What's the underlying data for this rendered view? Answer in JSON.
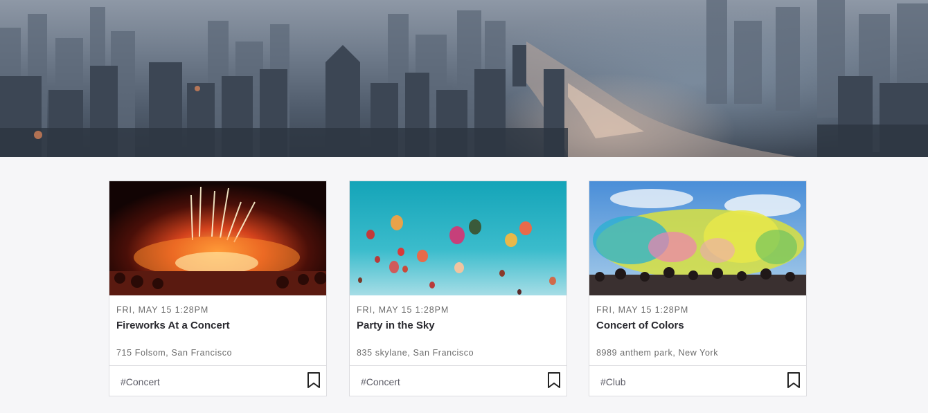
{
  "hero": {
    "icon": "city-skyline-image"
  },
  "cards": [
    {
      "date": "FRI, MAY 15 1:28PM",
      "title": "Fireworks At a Concert",
      "address": "715 Folsom, San Francisco",
      "tag": "#Concert",
      "image": "fireworks-concert-image"
    },
    {
      "date": "FRI, MAY 15 1:28PM",
      "title": "Party in the Sky",
      "address": "835 skylane, San Francisco",
      "tag": "#Concert",
      "image": "hot-air-balloons-image"
    },
    {
      "date": "FRI, MAY 15 1:28PM",
      "title": "Concert of Colors",
      "address": "8989 anthem park, New York",
      "tag": "#Club",
      "image": "color-powder-festival-image"
    }
  ],
  "colors": {
    "page_bg": "#f6f6f8",
    "card_border": "#dcdce0",
    "title": "#2a2a30",
    "meta": "#6b6b6b"
  }
}
